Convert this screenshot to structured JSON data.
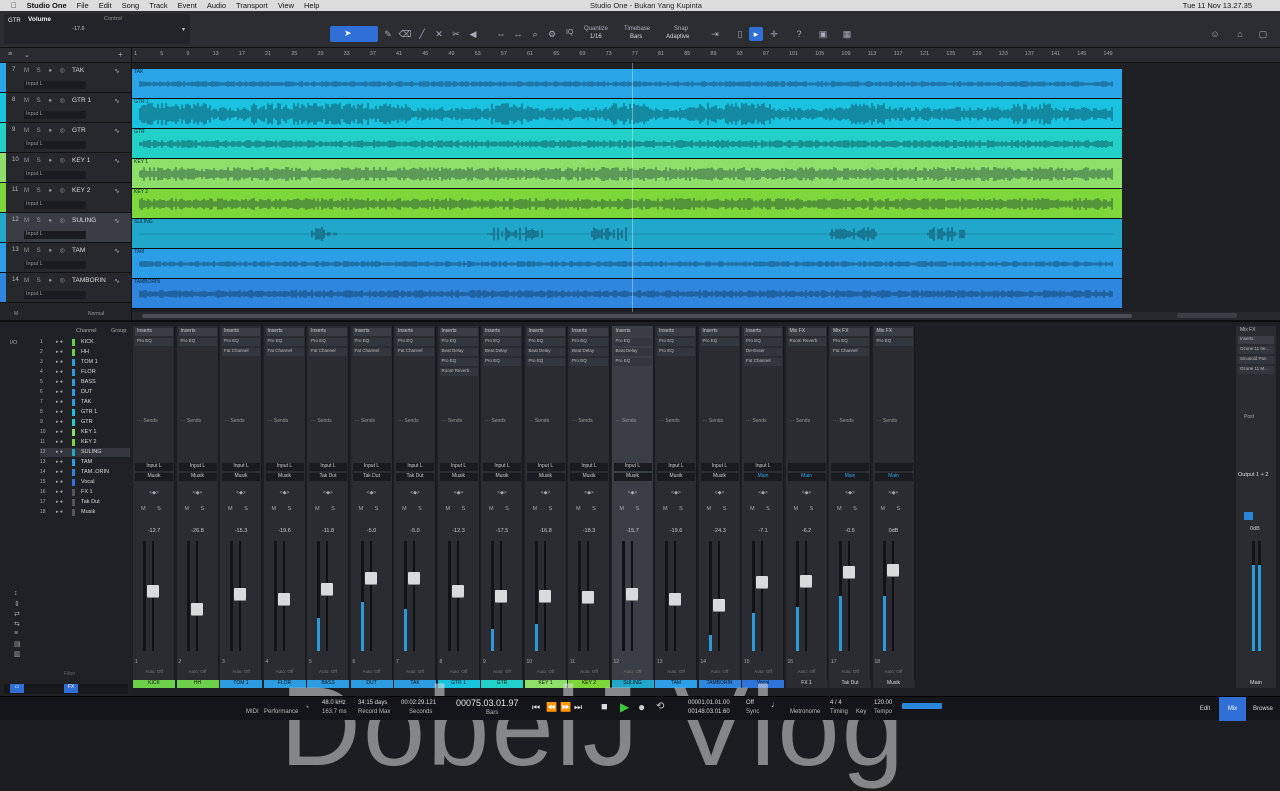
{
  "menubar": {
    "app": "Studio One",
    "items": [
      "File",
      "Edit",
      "Song",
      "Track",
      "Event",
      "Audio",
      "Transport",
      "View",
      "Help"
    ],
    "window_title": "Studio One - Bukan Yang Kupinta",
    "clock": "Tue 11 Nov  13.27.35"
  },
  "toolbar": {
    "track_label": "GTR",
    "param": "Volume",
    "param_value": "-17.6",
    "control_label": "Control",
    "quantize_label": "Quantize",
    "quantize_value": "1/16",
    "timebase_label": "Timebase",
    "timebase_value": "Bars",
    "snap_label": "Snap",
    "snap_value": "Adaptive",
    "iq": "IQ"
  },
  "ruler_ticks": [
    "1",
    "5",
    "9",
    "13",
    "17",
    "21",
    "25",
    "29",
    "33",
    "37",
    "41",
    "45",
    "49",
    "53",
    "57",
    "61",
    "65",
    "69",
    "73",
    "77",
    "81",
    "85",
    "89",
    "93",
    "97",
    "101",
    "105",
    "109",
    "113",
    "117",
    "121",
    "125",
    "129",
    "133",
    "137",
    "141",
    "145",
    "149"
  ],
  "tracks": [
    {
      "num": "7",
      "name": "TAK",
      "input": "Input L",
      "color": "#2aa6e8"
    },
    {
      "num": "8",
      "name": "GTR 1",
      "input": "Input L",
      "color": "#19c3e0"
    },
    {
      "num": "9",
      "name": "GTR",
      "input": "Input L",
      "color": "#22d0c7"
    },
    {
      "num": "10",
      "name": "KEY 1",
      "input": "Input L",
      "color": "#8ddf6a"
    },
    {
      "num": "11",
      "name": "KEY 2",
      "input": "Input L",
      "color": "#7dd63a"
    },
    {
      "num": "12",
      "name": "SULING",
      "input": "Input L",
      "color": "#21a7c9"
    },
    {
      "num": "13",
      "name": "TAM",
      "input": "Input L",
      "color": "#2c9ee8"
    },
    {
      "num": "14",
      "name": "TAMBORIN",
      "input": "Input L",
      "color": "#2f86df"
    }
  ],
  "lane_labels": [
    "TAK",
    "GTR 1",
    "GTR",
    "KEY 1",
    "KEY 2",
    "SULING",
    "TAM",
    "TAMBORIN"
  ],
  "normal_label": "Normal",
  "channel_list": {
    "header_channel": "Channel",
    "header_group": "Group",
    "io": "I/O",
    "items": [
      "KICK",
      "HH",
      "TOM 1",
      "FLOR",
      "BASS",
      "DUT",
      "TAK",
      "GTR 1",
      "GTR",
      "KEY 1",
      "KEY 2",
      "SULING",
      "TAM",
      "TAM..ORIN",
      "Vocal",
      "FX 1",
      "Tak Dut",
      "Musik"
    ],
    "filter": "Filter"
  },
  "strips": [
    {
      "name": "KICK",
      "num": "1",
      "db": "-12.7",
      "color": "#6cd04a",
      "plugs": [
        "Pro EQ"
      ],
      "io1": "Input L",
      "io2": "Musik",
      "level": 0.55,
      "meter": 0.0
    },
    {
      "name": "HH",
      "num": "2",
      "db": "-26.8",
      "color": "#6cd04a",
      "plugs": [
        "Pro EQ"
      ],
      "io1": "Input L",
      "io2": "Musik",
      "level": 0.38,
      "meter": 0.0
    },
    {
      "name": "TOM 1",
      "num": "3",
      "db": "-15.3",
      "color": "#2d9be0",
      "plugs": [
        "Pro EQ",
        "Fat Channel"
      ],
      "io1": "Input L",
      "io2": "Musik",
      "level": 0.52,
      "meter": 0.0
    },
    {
      "name": "FLOR",
      "num": "4",
      "db": "-19.6",
      "color": "#2d9be0",
      "plugs": [
        "Pro EQ",
        "Fat Channel"
      ],
      "io1": "Input L",
      "io2": "Musik",
      "level": 0.47,
      "meter": 0.0
    },
    {
      "name": "BASS",
      "num": "5",
      "db": "-11.8",
      "color": "#2d9be0",
      "plugs": [
        "Pro EQ",
        "Fat Channel"
      ],
      "io1": "Input L",
      "io2": "Tak Dut",
      "level": 0.56,
      "meter": 0.3
    },
    {
      "name": "DUT",
      "num": "6",
      "db": "-5.0",
      "color": "#2d9be0",
      "plugs": [
        "Pro EQ",
        "Fat Channel"
      ],
      "io1": "Input L",
      "io2": "Tak Dut",
      "level": 0.66,
      "meter": 0.45
    },
    {
      "name": "TAK",
      "num": "7",
      "db": "-5.0",
      "color": "#2d9be0",
      "plugs": [
        "Pro EQ",
        "Fat Channel"
      ],
      "io1": "Input L",
      "io2": "Tak Dut",
      "level": 0.66,
      "meter": 0.38
    },
    {
      "name": "GTR 1",
      "num": "8",
      "db": "-12.3",
      "color": "#19c3e0",
      "plugs": [
        "Pro EQ",
        "Beat Delay",
        "Pro EQ",
        "Room Reverb"
      ],
      "io1": "Input L",
      "io2": "Musik",
      "level": 0.55,
      "meter": 0.0
    },
    {
      "name": "GTR",
      "num": "9",
      "db": "-17.5",
      "color": "#22d0c7",
      "plugs": [
        "Pro EQ",
        "Beat Delay",
        "Pro EQ"
      ],
      "io1": "Input L",
      "io2": "Musik",
      "level": 0.5,
      "meter": 0.2
    },
    {
      "name": "KEY 1",
      "num": "10",
      "db": "-16.8",
      "color": "#8ddf6a",
      "plugs": [
        "Pro EQ",
        "Beat Delay",
        "Pro EQ"
      ],
      "io1": "Input L",
      "io2": "Musik",
      "level": 0.5,
      "meter": 0.25
    },
    {
      "name": "KEY 2",
      "num": "11",
      "db": "-18.3",
      "color": "#7dd63a",
      "plugs": [
        "Pro EQ",
        "Beat Delay",
        "Pro EQ"
      ],
      "io1": "Input L",
      "io2": "Musik",
      "level": 0.49,
      "meter": 0.0
    },
    {
      "name": "SULING",
      "num": "12",
      "db": "-15.7",
      "color": "#21a7c9",
      "plugs": [
        "Pro EQ",
        "Beat Delay",
        "Pro EQ"
      ],
      "io1": "Input L",
      "io2": "Musik",
      "level": 0.52,
      "meter": 0.0
    },
    {
      "name": "TAM",
      "num": "13",
      "db": "-19.6",
      "color": "#2c9ee8",
      "plugs": [
        "Pro EQ",
        "Pro EQ"
      ],
      "io1": "Input L",
      "io2": "Musik",
      "level": 0.47,
      "meter": 0.0
    },
    {
      "name": "TAMBORIN",
      "num": "14",
      "db": "-24.3",
      "color": "#2f86df",
      "plugs": [
        "Pro EQ"
      ],
      "io1": "Input L",
      "io2": "Musik",
      "level": 0.42,
      "meter": 0.15
    },
    {
      "name": "Vocal",
      "num": "15",
      "db": "-7.1",
      "color": "#2f74d8",
      "plugs": [
        "Pro EQ",
        "De-Esser",
        "Fat Channel"
      ],
      "io1": "Input L",
      "io2": "Main",
      "level": 0.63,
      "meter": 0.35
    },
    {
      "name": "FX 1",
      "num": "16",
      "db": "-6.2",
      "color": "#2a2c31",
      "plugs": [
        "Room Reverb"
      ],
      "io1": "",
      "io2": "Main",
      "level": 0.64,
      "meter": 0.4
    },
    {
      "name": "Tak Dut",
      "num": "17",
      "db": "-0.5",
      "color": "#2a2c31",
      "plugs": [
        "Pro EQ",
        "Fat Channel"
      ],
      "io1": "",
      "io2": "Main",
      "level": 0.72,
      "meter": 0.5
    },
    {
      "name": "Musik",
      "num": "18",
      "db": "0dB",
      "color": "#2a2c31",
      "plugs": [
        "Pro EQ"
      ],
      "io1": "",
      "io2": "Main",
      "level": 0.74,
      "meter": 0.5
    }
  ],
  "mixfx_label": "Mix FX",
  "main_strip": {
    "name": "Main",
    "inserts": [
      "Inserts",
      "Ozone 11 Im...",
      "Sinusoid Pan",
      "Ozone 11 M..."
    ],
    "post": "Post",
    "output": "Output 1 + 2",
    "db": "0dB"
  },
  "watermark": "DobelJ Vlog",
  "transport": {
    "midi": "MIDI",
    "performance": "Performance",
    "sample_rate": "48.0 kHz",
    "latency": "163.7 ms",
    "record_days": "34:15 days",
    "record_max": "Record Max",
    "seconds_time": "00:02:29.121",
    "seconds_label": "Seconds",
    "bars_time": "00075.03.01.97",
    "bars_label": "Bars",
    "loop_start": "00001.01.01.00",
    "loop_end": "00148.03.01.60",
    "sync": "Off",
    "sync_label": "Sync",
    "metronome": "Metronome",
    "timing": "4 / 4",
    "timing_label": "Timing",
    "key_label": "Key",
    "tempo": "120.00",
    "tempo_label": "Tempo",
    "edit": "Edit",
    "mix": "Mix",
    "browse": "Browse"
  },
  "colors": {
    "accent": "#2f6fd6",
    "select": "#2a86d8"
  }
}
